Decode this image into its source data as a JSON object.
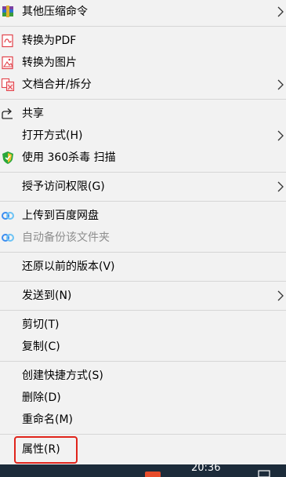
{
  "menu": {
    "items": [
      {
        "label": "其他压缩命令",
        "icon": "winrar-archive-icon"
      },
      {
        "label": "转换为PDF",
        "icon": "pdf-convert-icon"
      },
      {
        "label": "转换为图片",
        "icon": "image-convert-icon"
      },
      {
        "label": "文档合并/拆分",
        "icon": "doc-merge-split-icon"
      },
      {
        "label": "共享",
        "icon": "share-icon"
      },
      {
        "label": "打开方式(H)"
      },
      {
        "label": "使用 360杀毒 扫描",
        "icon": "360-shield-icon"
      },
      {
        "label": "授予访问权限(G)"
      },
      {
        "label": "上传到百度网盘",
        "icon": "baidu-cloud-icon"
      },
      {
        "label": "自动备份该文件夹",
        "icon": "baidu-cloud-icon"
      },
      {
        "label": "还原以前的版本(V)"
      },
      {
        "label": "发送到(N)"
      },
      {
        "label": "剪切(T)"
      },
      {
        "label": "复制(C)"
      },
      {
        "label": "创建快捷方式(S)"
      },
      {
        "label": "删除(D)"
      },
      {
        "label": "重命名(M)"
      },
      {
        "label": "属性(R)"
      }
    ]
  },
  "taskbar": {
    "clock": "20:36"
  },
  "colors": {
    "menu_bg": "#f2f2f2",
    "separator": "#d6d6d6",
    "highlight_border": "#e0241b",
    "disabled_text": "#8e8e8e",
    "taskbar_bg": "#1c2b3a"
  }
}
